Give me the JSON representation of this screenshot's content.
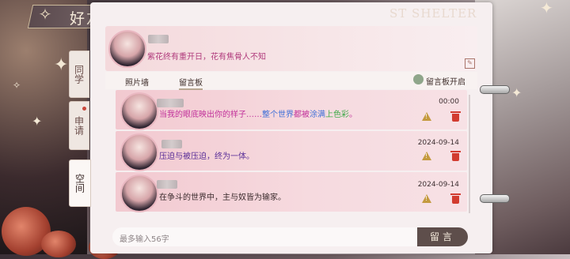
{
  "header": {
    "title": "好友",
    "watermark": "ST SHELTER"
  },
  "side_tabs": [
    {
      "label": "同学",
      "active": false,
      "dot": false
    },
    {
      "label": "申请",
      "active": false,
      "dot": true
    },
    {
      "label": "空间",
      "active": true,
      "dot": false
    }
  ],
  "profile": {
    "signature": "紫花终有重开日，花有焦骨人不知"
  },
  "subtabs": [
    {
      "label": "照片墙",
      "active": false
    },
    {
      "label": "留言板",
      "active": true
    }
  ],
  "board_toggle_label": "留言板开启",
  "messages": [
    {
      "segments": [
        {
          "text": "当我的眼底映出你的样子……",
          "color": "#c1309a"
        },
        {
          "text": "整个世界",
          "color": "#3e6fd8"
        },
        {
          "text": "都被",
          "color": "#c1309a"
        },
        {
          "text": "涂满",
          "color": "#3e6fd8"
        },
        {
          "text": "上色彩",
          "color": "#3faa49"
        },
        {
          "text": "。",
          "color": "#c1309a"
        }
      ],
      "date": "00:00"
    },
    {
      "segments": [
        {
          "text": "压迫与被压迫，终为一体。",
          "color": "#5a2f98"
        }
      ],
      "date": "2024-09-14"
    },
    {
      "segments": [
        {
          "text": "在争斗的世界中，主与奴皆为输家。",
          "color": "#3b2b2d"
        }
      ],
      "date": "2024-09-14"
    }
  ],
  "input": {
    "placeholder": "最多输入56字",
    "send_label": "留言"
  },
  "colors": {
    "accent": "#5e4e4b",
    "delete": "#d23c30",
    "warning": "#c49a3f",
    "signature": "#b03a7c"
  }
}
